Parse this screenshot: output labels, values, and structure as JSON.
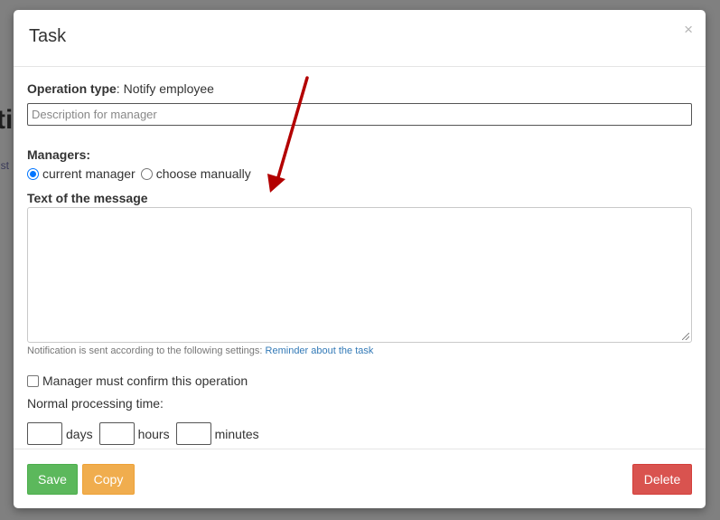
{
  "modal": {
    "title": "Task",
    "close_glyph": "×"
  },
  "operation": {
    "label": "Operation type",
    "separator": ":",
    "value": "Notify employee"
  },
  "description_input": {
    "placeholder": "Description for manager",
    "value": ""
  },
  "managers": {
    "label": "Managers:",
    "options": [
      {
        "label": "current manager",
        "checked": true
      },
      {
        "label": "choose manually",
        "checked": false
      }
    ]
  },
  "message": {
    "label": "Text of the message",
    "value": ""
  },
  "notification": {
    "text": "Notification is sent according to the following settings: ",
    "link_text": "Reminder about the task"
  },
  "confirm": {
    "label": "Manager must confirm this operation",
    "checked": false
  },
  "processing_time": {
    "label": "Normal processing time:",
    "units": [
      "days",
      "hours",
      "minutes"
    ],
    "values": [
      "",
      "",
      ""
    ]
  },
  "footer": {
    "save_label": "Save",
    "copy_label": "Copy",
    "delete_label": "Delete"
  },
  "colors": {
    "save": "#5cb85c",
    "copy": "#f0ad4e",
    "delete": "#d9534f",
    "link": "#337ab7",
    "radio_accent": "#0075ff",
    "annotation_arrow": "#b30000"
  }
}
